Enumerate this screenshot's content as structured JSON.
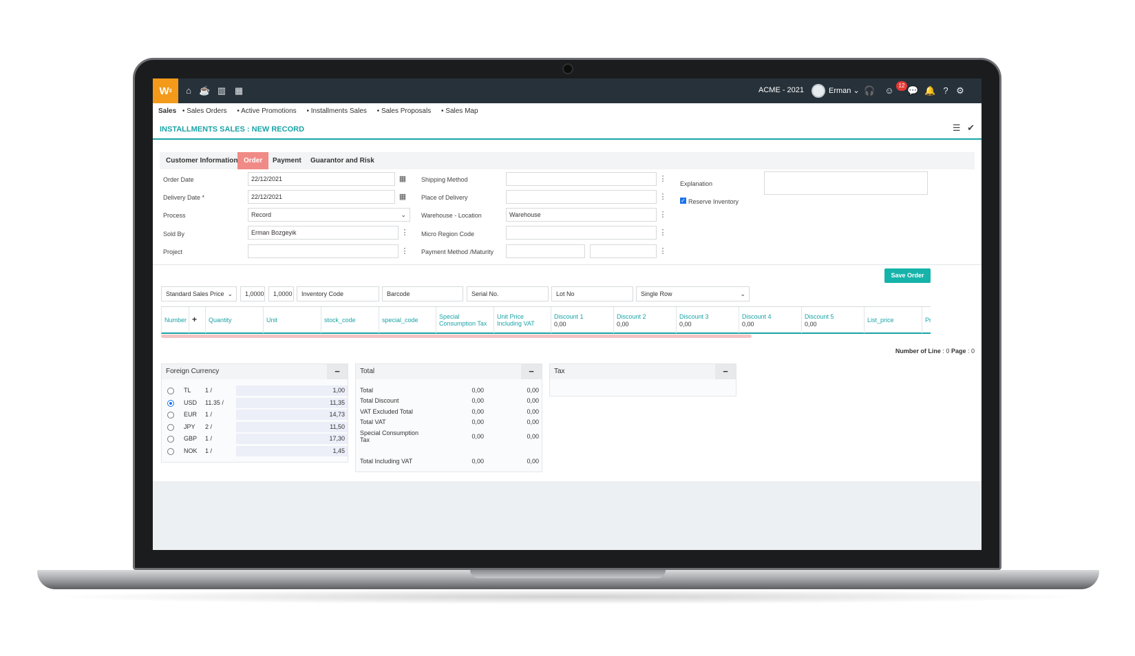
{
  "header": {
    "logo": "W",
    "company": "ACME - 2021",
    "user": "Erman",
    "notifications": "12",
    "icons": [
      "home-icon",
      "cup-icon",
      "bar-chart-icon",
      "calendar-icon",
      "headset-icon",
      "smiley-icon",
      "chat-icon",
      "bell-icon",
      "help-icon",
      "gear-icon"
    ]
  },
  "breadcrumb": {
    "root": "Sales",
    "items": [
      "Sales Orders",
      "Active Promotions",
      "Installments Sales",
      "Sales Proposals",
      "Sales Map"
    ]
  },
  "page": {
    "title": "INSTALLMENTS SALES : NEW RECORD"
  },
  "tabs": [
    "Customer Information",
    "Order",
    "Payment",
    "Guarantor and Risk"
  ],
  "active_tab": "Order",
  "form": {
    "order_date_label": "Order Date",
    "order_date": "22/12/2021",
    "delivery_date_label": "Delivery Date *",
    "delivery_date": "22/12/2021",
    "process_label": "Process",
    "process": "Record",
    "sold_by_label": "Sold By",
    "sold_by": "Erman Bozgeyik",
    "project_label": "Project",
    "project": "",
    "shipping_method_label": "Shipping Method",
    "shipping_method": "",
    "place_of_delivery_label": "Place of Delivery",
    "place_of_delivery": "",
    "warehouse_label": "Warehouse - Location",
    "warehouse": "Warehouse",
    "micro_region_label": "Micro Region Code",
    "micro_region": "",
    "payment_method_label": "Payment Method /Maturity",
    "explanation_label": "Explanation",
    "reserve_inventory_label": "Reserve Inventory",
    "reserve_inventory": true
  },
  "save_button": "Save Order",
  "filters": {
    "price_list": "Standard Sales Price",
    "multiplier_1": "1,0000",
    "multiplier_2": "1,0000",
    "inventory_code": "Inventory Code",
    "barcode": "Barcode",
    "serial_no": "Serial No.",
    "lot_no": "Lot No",
    "row_mode": "Single Row"
  },
  "grid": {
    "columns": [
      {
        "label": "Number"
      },
      {
        "label": "+"
      },
      {
        "label": "Quantity"
      },
      {
        "label": "Unit"
      },
      {
        "label": "stock_code"
      },
      {
        "label": "special_code"
      },
      {
        "label": "Special Consumption Tax"
      },
      {
        "label": "Unit Price Including VAT"
      },
      {
        "label": "Discount 1",
        "value": "0,00"
      },
      {
        "label": "Discount 2",
        "value": "0,00"
      },
      {
        "label": "Discount 3",
        "value": "0,00"
      },
      {
        "label": "Discount 4",
        "value": "0,00"
      },
      {
        "label": "Discount 5",
        "value": "0,00"
      },
      {
        "label": "List_price"
      },
      {
        "label": "Pri"
      }
    ],
    "number_of_line_label": "Number of Line",
    "number_of_line": "0",
    "page_label": "Page",
    "page": "0"
  },
  "foreign_currency": {
    "title": "Foreign Currency",
    "selected": "USD",
    "rows": [
      {
        "code": "TL",
        "rate": "1 /",
        "value": "1,00"
      },
      {
        "code": "USD",
        "rate": "11.35 /",
        "value": "11,35"
      },
      {
        "code": "EUR",
        "rate": "1 /",
        "value": "14,73"
      },
      {
        "code": "JPY",
        "rate": "2 /",
        "value": "11,50"
      },
      {
        "code": "GBP",
        "rate": "1 /",
        "value": "17,30"
      },
      {
        "code": "NOK",
        "rate": "1 /",
        "value": "1,45"
      }
    ]
  },
  "totals": {
    "title": "Total",
    "rows": [
      {
        "name": "Total",
        "a": "0,00",
        "b": "0,00"
      },
      {
        "name": "Total Discount",
        "a": "0,00",
        "b": "0,00"
      },
      {
        "name": "VAT Excluded Total",
        "a": "0,00",
        "b": "0,00"
      },
      {
        "name": "Total VAT",
        "a": "0,00",
        "b": "0,00"
      },
      {
        "name": "Special Consumption Tax",
        "a": "0,00",
        "b": "0,00"
      },
      {
        "name": "Total Including VAT",
        "a": "0,00",
        "b": "0,00"
      }
    ]
  },
  "tax": {
    "title": "Tax"
  },
  "colors": {
    "accent": "#1aa3a6",
    "topbar": "#27313a",
    "logo": "#f39a1b",
    "active_tab": "#f08a86",
    "save_button": "#16b3aa"
  }
}
